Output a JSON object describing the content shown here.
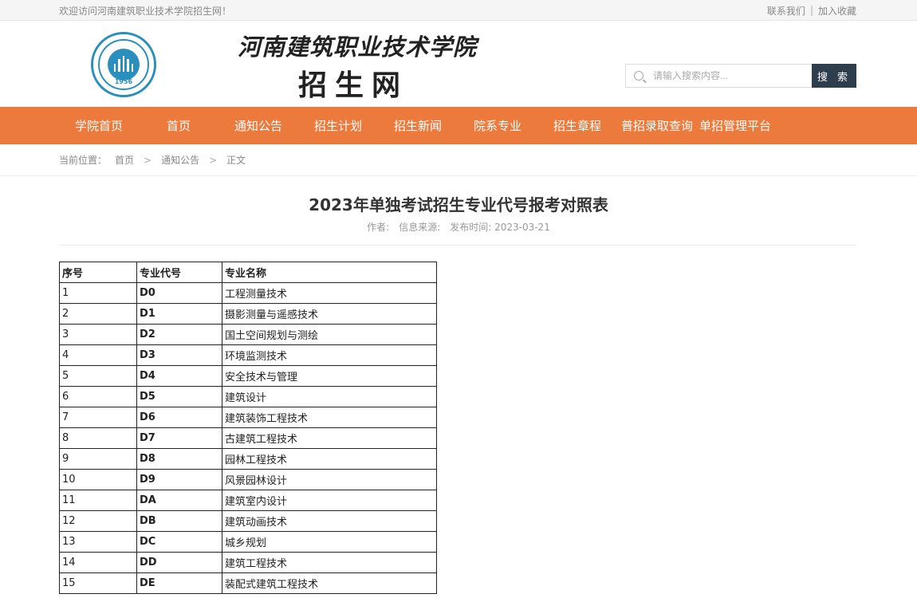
{
  "topbar": {
    "welcome": "欢迎访问河南建筑职业技术学院招生网！",
    "contact": "联系我们",
    "sep": "|",
    "favorite": "加入收藏"
  },
  "header": {
    "logo_year": "1956",
    "brand_name": "河南建筑职业技术学院",
    "brand_sub": "招生网",
    "search_placeholder": "请输入搜索内容...",
    "search_button": "搜 索"
  },
  "nav": {
    "items": [
      "学院首页",
      "首页",
      "通知公告",
      "招生计划",
      "招生新闻",
      "院系专业",
      "招生章程",
      "普招录取查询",
      "单招管理平台"
    ]
  },
  "breadcrumb": {
    "prefix": "当前位置：",
    "items": [
      "首页",
      "通知公告",
      "正文"
    ],
    "sep": ">"
  },
  "article": {
    "title": "2023年单独考试招生专业代号报考对照表",
    "author_label": "作者:",
    "source_label": "信息来源:",
    "date_label": "发布时间: 2023-03-21"
  },
  "table": {
    "headers": [
      "序号",
      "专业代号",
      "专业名称"
    ],
    "rows": [
      [
        "1",
        "D0",
        "工程测量技术"
      ],
      [
        "2",
        "D1",
        "摄影测量与遥感技术"
      ],
      [
        "3",
        "D2",
        "国土空间规划与测绘"
      ],
      [
        "4",
        "D3",
        "环境监测技术"
      ],
      [
        "5",
        "D4",
        "安全技术与管理"
      ],
      [
        "6",
        "D5",
        "建筑设计"
      ],
      [
        "7",
        "D6",
        "建筑装饰工程技术"
      ],
      [
        "8",
        "D7",
        "古建筑工程技术"
      ],
      [
        "9",
        "D8",
        "园林工程技术"
      ],
      [
        "10",
        "D9",
        "风景园林设计"
      ],
      [
        "11",
        "DA",
        "建筑室内设计"
      ],
      [
        "12",
        "DB",
        "建筑动画技术"
      ],
      [
        "13",
        "DC",
        "城乡规划"
      ],
      [
        "14",
        "DD",
        "建筑工程技术"
      ],
      [
        "15",
        "DE",
        "装配式建筑工程技术"
      ]
    ]
  }
}
